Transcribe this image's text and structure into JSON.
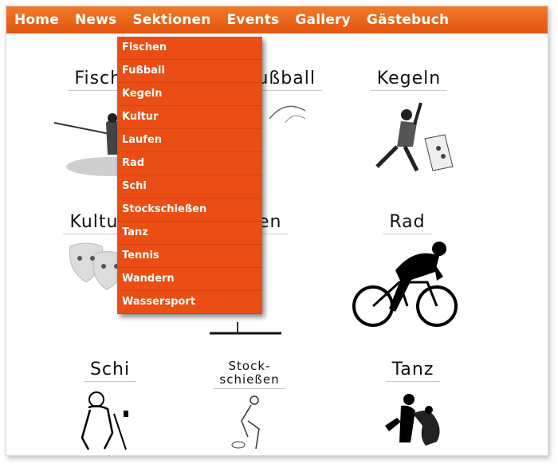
{
  "nav": {
    "items": [
      "Home",
      "News",
      "Sektionen",
      "Events",
      "Gallery",
      "Gästebuch"
    ]
  },
  "dropdown": {
    "items": [
      "Fischen",
      "Fußball",
      "Kegeln",
      "Kultur",
      "Laufen",
      "Rad",
      "Schi",
      "Stockschießen",
      "Tanz",
      "Tennis",
      "Wandern",
      "Wassersport"
    ]
  },
  "tiles": {
    "fischen": "Fischen",
    "fussball": "Fußball",
    "kegeln": "Kegeln",
    "kultur": "Kultur",
    "laufen": "Laufen",
    "rad": "Rad",
    "schi": "Schi",
    "stock_line1": "Stock-",
    "stock_line2": "schießen",
    "tanz": "Tanz"
  },
  "colors": {
    "nav_bg": "#e8611c",
    "dropdown_bg": "#ea4e14",
    "text_white": "#ffffff"
  }
}
